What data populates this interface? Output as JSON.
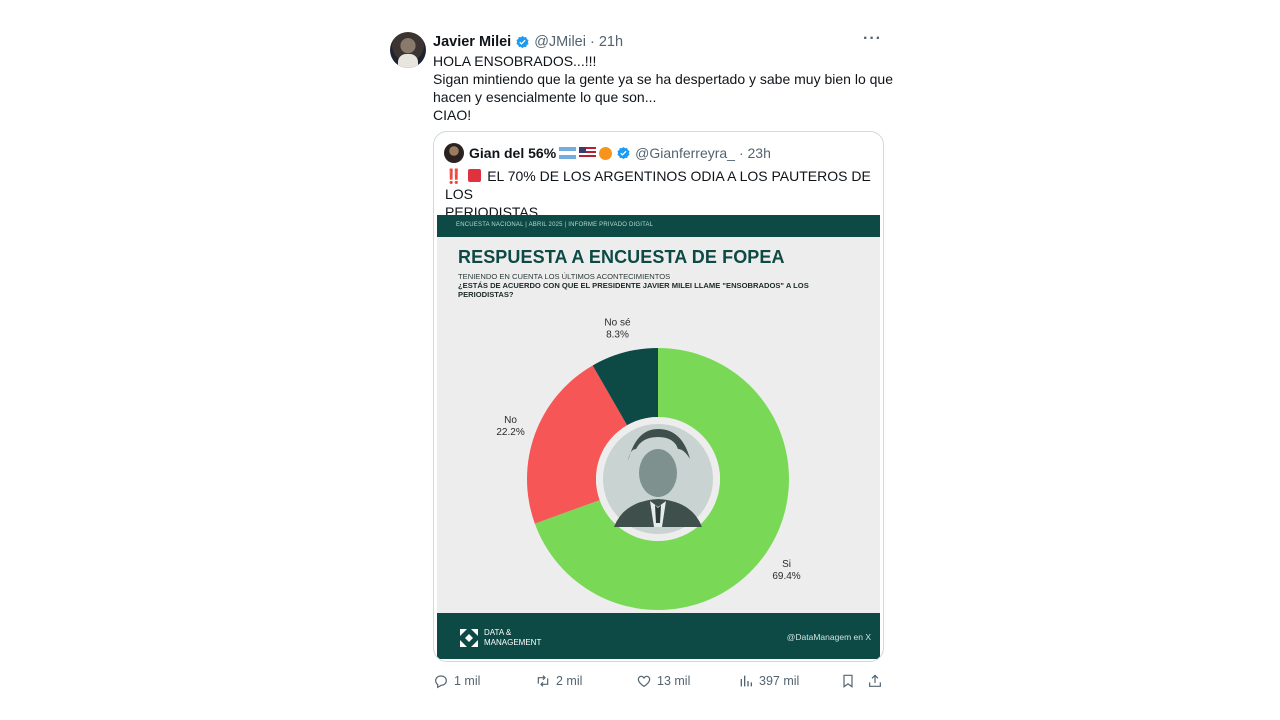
{
  "tweet": {
    "author_name": "Javier Milei",
    "handle": "@JMilei",
    "time": "· 21h",
    "more_label": "···",
    "lines": [
      "HOLA ENSOBRADOS...!!!",
      "Sigan mintiendo que la gente ya se ha despertado y sabe muy bien lo que",
      "hacen y esencialmente lo que son...",
      "CIAO!"
    ]
  },
  "quote": {
    "author_name": "Gian del 56%",
    "handle": "@Gianferreyra_",
    "time": "· 23h",
    "alert_marks": "‼️",
    "text_line1": "EL 70% DE LOS ARGENTINOS ODIA A LOS PAUTEROS DE LOS",
    "text_line2": "PERIODISTAS"
  },
  "infographic": {
    "topbar": "ENCUESTA NACIONAL   |   ABRIL 2025   |   INFORME PRIVADO DIGITAL",
    "title": "RESPUESTA A ENCUESTA DE FOPEA",
    "subtitle": "TENIENDO EN CUENTA LOS ÚLTIMOS ACONTECIMIENTOS",
    "question": "¿ESTÁS DE ACUERDO CON QUE EL PRESIDENTE JAVIER MILEI LLAME \"ENSOBRADOS\" A LOS PERIODISTAS?",
    "logo_line1": "DATA &",
    "logo_line2": "MANAGEMENT",
    "handle": "@DataManagem en X"
  },
  "chart_data": {
    "type": "pie",
    "donut": true,
    "categories": [
      "Si",
      "No",
      "No sé"
    ],
    "values": [
      69.4,
      22.2,
      8.3
    ],
    "value_labels": [
      "69.4%",
      "22.2%",
      "8.3%"
    ],
    "colors": [
      "#79d956",
      "#f65656",
      "#0d4a45"
    ],
    "start": "top, clockwise"
  },
  "actions": {
    "reply_count": "1 mil",
    "retweet_count": "2 mil",
    "like_count": "13 mil",
    "views_count": "397 mil"
  },
  "icons": [
    "verified-badge-icon",
    "more-icon",
    "reply-icon",
    "retweet-icon",
    "like-icon",
    "views-icon",
    "bookmark-icon",
    "share-icon"
  ],
  "colors": {
    "verified": "#1d9bf0",
    "muted_text": "#536471",
    "infographic_teal": "#0d4a45"
  }
}
